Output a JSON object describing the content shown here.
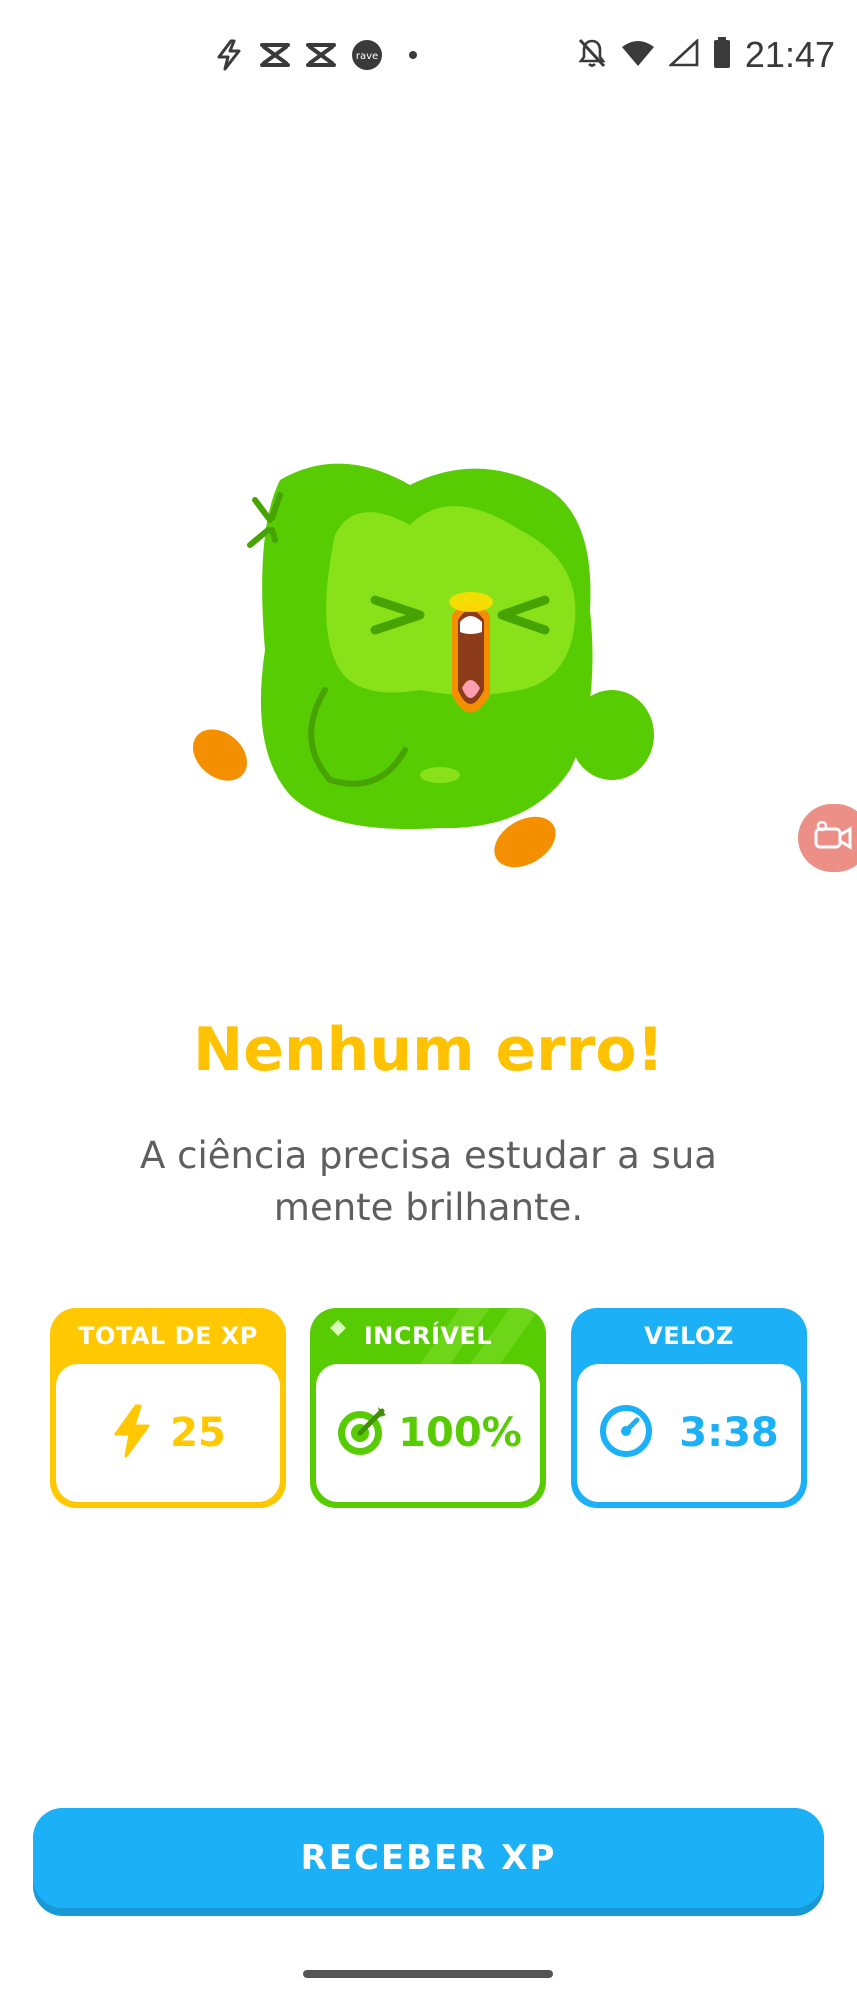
{
  "status_bar": {
    "time": "21:47",
    "left_icons": [
      "flash-icon",
      "capcut-icon",
      "capcut-icon",
      "rave-icon",
      "dot-icon"
    ],
    "right_icons": [
      "bell-off-icon",
      "wifi-icon",
      "signal-icon",
      "battery-icon"
    ],
    "rave_label": "rave"
  },
  "result": {
    "title": "Nenhum erro!",
    "subtitle": "A ciência precisa estudar a sua mente brilhante."
  },
  "cards": [
    {
      "label": "TOTAL DE XP",
      "value": "25",
      "icon": "lightning-icon",
      "color": "#ffc800"
    },
    {
      "label": "INCRÍVEL",
      "value": "100%",
      "icon": "target-icon",
      "color": "#58cc02"
    },
    {
      "label": "VELOZ",
      "value": "3:38",
      "icon": "timer-icon",
      "color": "#1cb0f6"
    }
  ],
  "button": {
    "label": "RECEBER XP"
  },
  "colors": {
    "title": "#ffc200",
    "accent_blue": "#1cb0f6",
    "green": "#58cc02",
    "gold": "#ffc800"
  }
}
